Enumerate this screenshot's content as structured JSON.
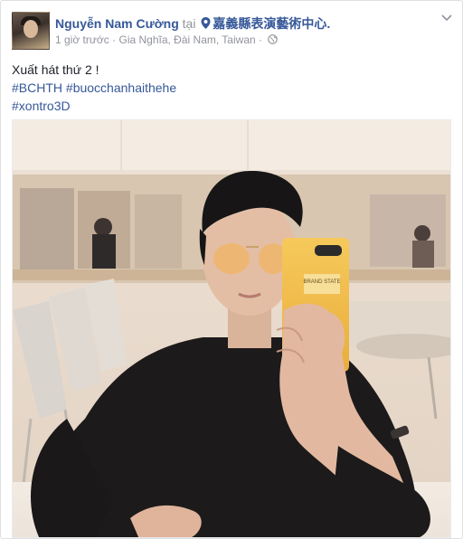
{
  "post": {
    "author": "Nguyễn Nam Cường",
    "connector": "tại",
    "location": "嘉義縣表演藝術中心.",
    "time": "1 giờ trước",
    "separator": "·",
    "place": "Gia Nghĩa, Đài Nam, Taiwan",
    "privacy_sep": "·",
    "privacy_icon": "globe-icon",
    "location_icon": "map-pin-icon",
    "menu_icon": "chevron-down-icon",
    "caption_line1": "Xuất hát thứ 2 !",
    "hashtag1": "#BCHTH",
    "hashtag2": "#buocchanhaithehe",
    "hashtag3": "#xontro3D",
    "phone_label": "BRAND STATE"
  },
  "colors": {
    "link": "#365899",
    "muted": "#90949c",
    "text": "#1d2129",
    "phone": "#f2c04a"
  }
}
